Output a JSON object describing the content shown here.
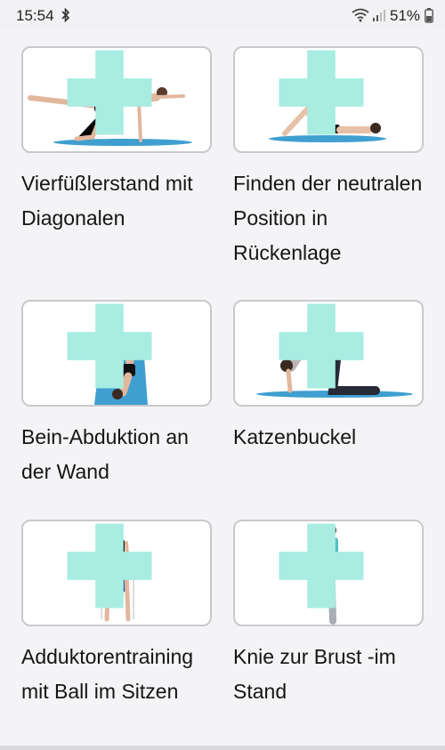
{
  "status_bar": {
    "time": "15:54",
    "battery": "51%",
    "icons": [
      "bluetooth-icon",
      "wifi-icon",
      "signal-icon",
      "battery-icon"
    ]
  },
  "exercises": [
    {
      "title": "Vierfüßlerstand mit Diagonalen",
      "image": "exercise-photo-quadruped"
    },
    {
      "title": "Finden der neutralen Position in Rückenlage",
      "image": "exercise-photo-supine"
    },
    {
      "title": "Bein-Abduktion an der Wand",
      "image": "exercise-photo-wall-abduction"
    },
    {
      "title": "Katzenbuckel",
      "image": "exercise-photo-cat-pose"
    },
    {
      "title": "Adduktorentraining mit Ball im Sitzen",
      "image": "exercise-photo-seated-ball"
    },
    {
      "title": "Knie zur Brust -im Stand",
      "image": "exercise-photo-standing-knee"
    }
  ],
  "colors": {
    "mat": "#3f9fd0",
    "plus": "#a8ece2",
    "card_border": "#c9c9cc"
  }
}
